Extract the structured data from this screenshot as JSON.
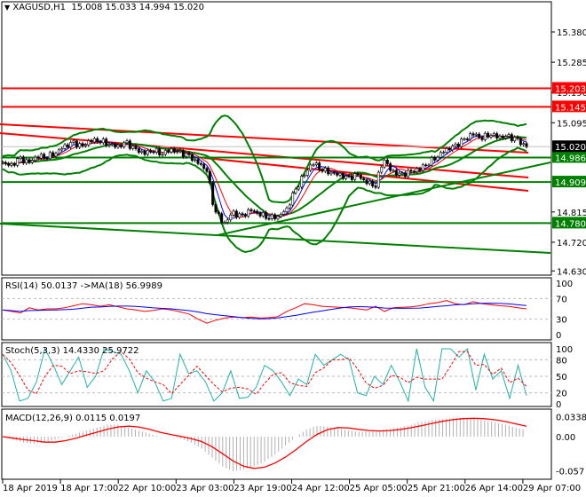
{
  "header": {
    "symbol": "XAGUSD,H1",
    "open": "15.008",
    "high": "15.033",
    "low": "14.994",
    "close": "15.020"
  },
  "colors": {
    "up": "#000000",
    "red": "#ff0000",
    "green": "#008000",
    "blue": "#0000ff",
    "teal": "#20b2aa",
    "hist": "#b0b0b0"
  },
  "chart_data": [
    {
      "type": "line",
      "title": "XAGUSD,H1 price",
      "ylim": [
        14.6,
        15.43
      ],
      "yticks": [
        "15.380",
        "15.285",
        "15.190",
        "15.095",
        "14.815",
        "14.720",
        "14.630"
      ],
      "levels": [
        {
          "label": "15.203",
          "value": 15.203,
          "color": "red"
        },
        {
          "label": "15.145",
          "value": 15.145,
          "color": "red"
        },
        {
          "label": "14.986",
          "value": 14.986,
          "color": "green"
        },
        {
          "label": "14.909",
          "value": 14.909,
          "color": "green"
        },
        {
          "label": "14.780",
          "value": 14.78,
          "color": "green"
        }
      ],
      "current_price": "15.020",
      "closes": [
        14.97,
        14.96,
        14.98,
        14.97,
        14.99,
        14.99,
        15.0,
        15.02,
        15.03,
        15.02,
        15.04,
        15.04,
        15.03,
        15.02,
        15.03,
        15.01,
        15.0,
        15.01,
        15.0,
        15.01,
        15.0,
        14.99,
        14.97,
        14.95,
        14.82,
        14.78,
        14.81,
        14.8,
        14.82,
        14.81,
        14.8,
        14.8,
        14.82,
        14.88,
        14.93,
        14.97,
        14.95,
        14.94,
        14.93,
        14.92,
        14.93,
        14.91,
        14.9,
        14.98,
        14.94,
        14.93,
        14.94,
        14.95,
        14.97,
        14.99,
        15.01,
        15.02,
        15.04,
        15.06,
        15.05,
        15.06,
        15.05,
        15.05,
        15.04,
        15.02
      ]
    },
    {
      "type": "line",
      "title": "RSI(14) 50.0137  ->MA(18) 56.9989",
      "ylim": [
        0,
        100
      ],
      "yticks": [
        "100",
        "70",
        "30",
        "0"
      ],
      "values": [
        48,
        45,
        42,
        52,
        48,
        50,
        50,
        52,
        56,
        60,
        58,
        55,
        58,
        54,
        50,
        48,
        45,
        47,
        50,
        48,
        44,
        40,
        30,
        22,
        28,
        32,
        34,
        33,
        34,
        32,
        33,
        35,
        45,
        52,
        60,
        58,
        55,
        54,
        53,
        52,
        50,
        48,
        55,
        45,
        52,
        53,
        54,
        56,
        60,
        62,
        66,
        60,
        58,
        64,
        60,
        58,
        56,
        55,
        52,
        50
      ]
    },
    {
      "type": "line",
      "title": "Stoch(5,3,3) 14.4330 25.9722",
      "ylim": [
        0,
        100
      ],
      "yticks": [
        "100",
        "80",
        "50",
        "20",
        "0"
      ],
      "values": [
        90,
        60,
        5,
        10,
        40,
        100,
        70,
        35,
        60,
        85,
        30,
        50,
        100,
        95,
        90,
        60,
        20,
        60,
        40,
        5,
        10,
        90,
        55,
        60,
        40,
        5,
        20,
        60,
        10,
        12,
        30,
        70,
        60,
        40,
        15,
        45,
        35,
        90,
        70,
        80,
        90,
        80,
        20,
        15,
        50,
        35,
        70,
        40,
        5,
        100,
        30,
        5,
        100,
        100,
        85,
        100,
        25,
        90,
        45,
        60,
        10,
        70,
        15
      ]
    },
    {
      "type": "bar",
      "title": "MACD(12,26,9) 0.0115 0.0197",
      "ylim": [
        -0.06,
        0.036
      ],
      "yticks": [
        "0.0338",
        "0.00",
        "-0.057"
      ],
      "values": [
        0,
        -0.005,
        -0.01,
        -0.012,
        -0.01,
        -0.005,
        0,
        0.005,
        0.01,
        0.015,
        0.02,
        0.02,
        0.015,
        0.01,
        0.005,
        0,
        0,
        -0.003,
        -0.01,
        -0.02,
        -0.035,
        -0.05,
        -0.058,
        -0.055,
        -0.05,
        -0.042,
        -0.03,
        -0.015,
        0,
        0.012,
        0.018,
        0.017,
        0.014,
        0.01,
        0.008,
        0.009,
        0.011,
        0.013,
        0.016,
        0.02,
        0.025,
        0.028,
        0.03,
        0.031,
        0.032,
        0.03,
        0.027,
        0.024,
        0.02,
        0.015,
        0.0115
      ]
    }
  ],
  "xaxis": [
    "18 Apr 2019",
    "18 Apr 17:00",
    "22 Apr 10:00",
    "23 Apr 03:00",
    "23 Apr 19:00",
    "24 Apr 12:00",
    "25 Apr 05:00",
    "25 Apr 21:00",
    "26 Apr 14:00",
    "29 Apr 07:00"
  ]
}
